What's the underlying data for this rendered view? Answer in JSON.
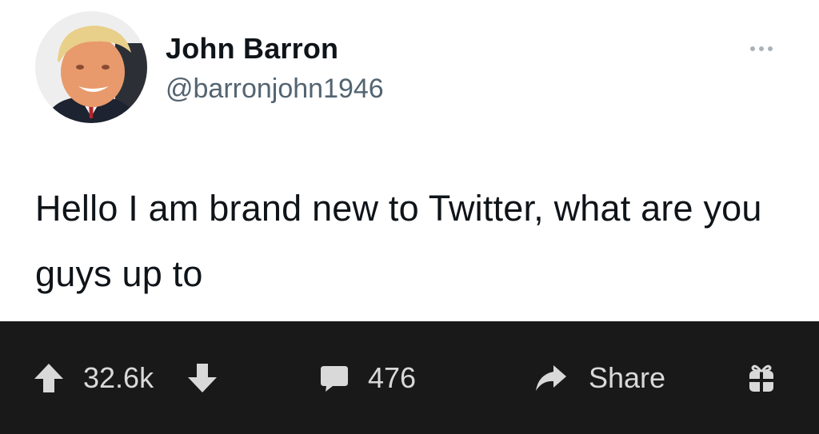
{
  "tweet": {
    "display_name": "John Barron",
    "handle": "@barronjohn1946",
    "text": "Hello I am brand new to Twitter, what are you guys up to",
    "more_icon": "more-horizontal-icon",
    "avatar_icon": "profile-photo"
  },
  "actions": {
    "upvote_icon": "arrow-up-icon",
    "score": "32.6k",
    "downvote_icon": "arrow-down-icon",
    "comment_icon": "comment-bubble-icon",
    "comment_count": "476",
    "share_icon": "share-arrow-icon",
    "share_label": "Share",
    "award_icon": "gift-icon"
  },
  "colors": {
    "tweet_background": "#ffffff",
    "name_text": "#0f1419",
    "handle_text": "#536471",
    "bar_background": "#191919",
    "bar_text": "#d9d9d9"
  }
}
